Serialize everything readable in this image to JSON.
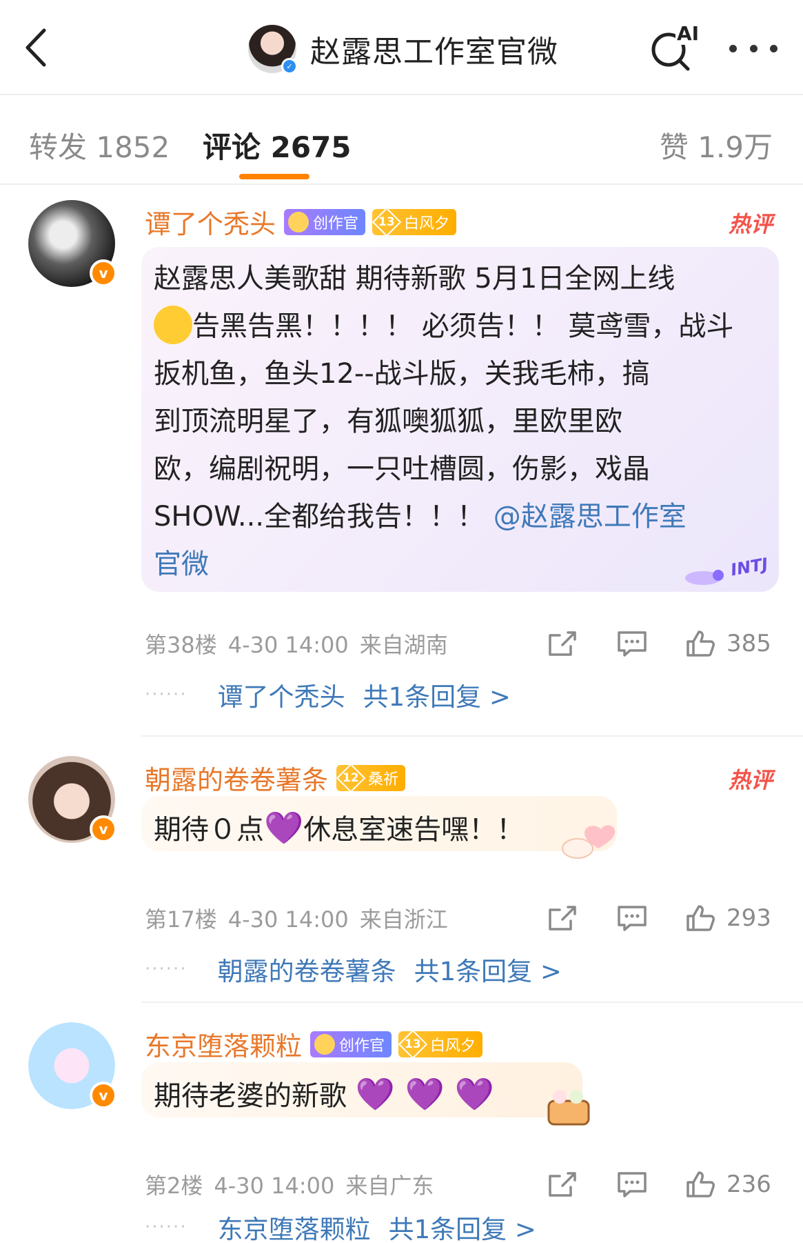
{
  "header": {
    "title": "赵露思工作室官微",
    "back_icon": "chevron-left-icon",
    "search_icon": "ai-search-icon",
    "ai_label": "AI",
    "more_icon": "ellipsis-icon"
  },
  "tabs": {
    "repost": "转发 1852",
    "comment": "评论 2675",
    "like": "赞 1.9万",
    "accent": "#ff8200"
  },
  "comments": [
    {
      "username": "谭了个秃头",
      "badge_creator": "创作官",
      "badge_level_num": "13",
      "badge_level_name": "白风夕",
      "hot": "热评",
      "text_lines": [
        "赵露思人美歌甜 期待新歌 5月1日全网上线",
        "告黑告黑！！！！ 必须告！！ 莫鸢雪，战斗",
        "扳机鱼，鱼头12--战斗版，关我毛柿，搞",
        "到顶流明星了，有狐噢狐狐，里欧里欧",
        "欧，编剧祝明，一只吐槽圆，伤影，戏晶",
        " SHOW...全都给我告！！！ "
      ],
      "mention": "@赵露思工作室",
      "mention_tail": "官微",
      "sticker_text": "INTJ",
      "floor": "第38楼",
      "time": "4-30 14:00",
      "location": "来自湖南",
      "likes": "385",
      "reply_name": "谭了个秃头",
      "reply_count": "共1条回复 >"
    },
    {
      "username": "朝露的卷卷薯条",
      "badge_level_num": "12",
      "badge_level_name": "桑祈",
      "hot": "热评",
      "text_before": "期待０点",
      "heart": "💜",
      "text_after": "休息室速告嘿！！",
      "floor": "第17楼",
      "time": "4-30 14:00",
      "location": "来自浙江",
      "likes": "293",
      "reply_name": "朝露的卷卷薯条",
      "reply_count": "共1条回复 >"
    },
    {
      "username": "东京堕落颗粒",
      "badge_creator": "创作官",
      "badge_level_num": "13",
      "badge_level_name": "白风夕",
      "text": "期待老婆的新歌",
      "hearts": "💜 💜 💜",
      "floor": "第2楼",
      "time": "4-30 14:00",
      "location": "来自广东",
      "likes": "236",
      "reply_name": "东京堕落颗粒",
      "reply_count": "共1条回复 >"
    }
  ]
}
